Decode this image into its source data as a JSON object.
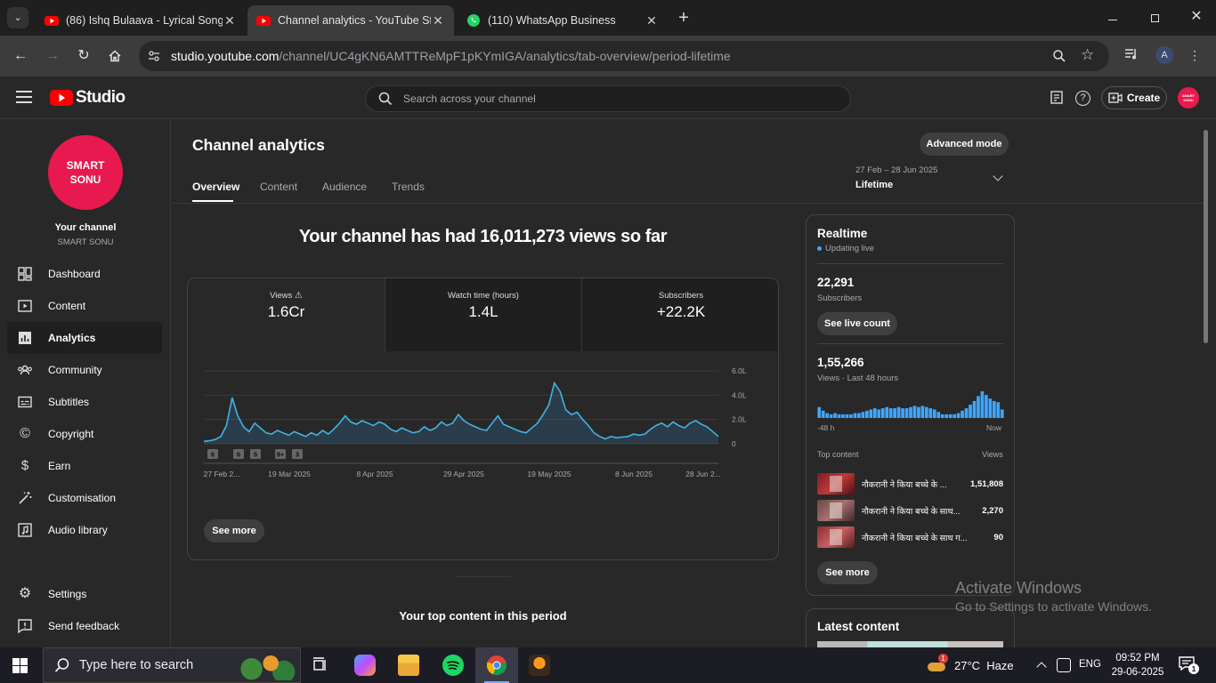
{
  "browser": {
    "tabs": [
      {
        "title": "(86) Ishq Bulaava - Lyrical Song",
        "icon": "youtube-icon"
      },
      {
        "title": "Channel analytics - YouTube Studio",
        "icon": "youtube-icon"
      },
      {
        "title": "(110) WhatsApp Business",
        "icon": "whatsapp-icon"
      }
    ],
    "url_host": "studio.youtube.com",
    "url_path": "/channel/UC4gKN6AMTTReMpF1pKYmIGA/analytics/tab-overview/period-lifetime",
    "profile_initial": "A"
  },
  "header": {
    "logo_text": "Studio",
    "search_placeholder": "Search across your channel",
    "create_label": "Create",
    "avatar_text": "SMART SONU"
  },
  "sidebar": {
    "avatar_text": "SMART SONU",
    "your_channel": "Your channel",
    "channel_name": "SMART SONU",
    "items": [
      {
        "label": "Dashboard",
        "icon": "dashboard-icon"
      },
      {
        "label": "Content",
        "icon": "content-icon"
      },
      {
        "label": "Analytics",
        "icon": "analytics-icon"
      },
      {
        "label": "Community",
        "icon": "community-icon"
      },
      {
        "label": "Subtitles",
        "icon": "subtitles-icon"
      },
      {
        "label": "Copyright",
        "icon": "copyright-icon"
      },
      {
        "label": "Earn",
        "icon": "earn-icon"
      },
      {
        "label": "Customisation",
        "icon": "customisation-icon"
      },
      {
        "label": "Audio library",
        "icon": "audio-library-icon"
      }
    ],
    "settings": "Settings",
    "feedback": "Send feedback"
  },
  "page": {
    "title": "Channel analytics",
    "advanced_mode": "Advanced mode",
    "tabs": [
      "Overview",
      "Content",
      "Audience",
      "Trends"
    ],
    "period_range": "27 Feb – 28 Jun 2025",
    "period_label": "Lifetime",
    "headline": "Your channel has had 16,011,273 views so far",
    "metrics": [
      {
        "label": "Views",
        "value": "1.6Cr"
      },
      {
        "label": "Watch time (hours)",
        "value": "1.4L"
      },
      {
        "label": "Subscribers",
        "value": "+22.2K"
      }
    ],
    "see_more": "See more",
    "top_content_heading": "Your top content in this period"
  },
  "chart_data": {
    "type": "area",
    "x_ticks": [
      "27 Feb 2...",
      "19 Mar 2025",
      "8 Apr 2025",
      "29 Apr 2025",
      "19 May 2025",
      "8 Jun 2025",
      "28 Jun 2..."
    ],
    "y_ticks": [
      "6.0L",
      "4.0L",
      "2.0L",
      "0"
    ],
    "ylim": [
      0,
      600000
    ],
    "values": [
      20000,
      25000,
      35000,
      60000,
      150000,
      380000,
      230000,
      140000,
      100000,
      170000,
      130000,
      90000,
      80000,
      110000,
      90000,
      70000,
      100000,
      80000,
      60000,
      90000,
      70000,
      110000,
      80000,
      120000,
      170000,
      230000,
      180000,
      160000,
      190000,
      170000,
      150000,
      180000,
      160000,
      120000,
      100000,
      130000,
      110000,
      90000,
      100000,
      140000,
      110000,
      130000,
      180000,
      150000,
      170000,
      240000,
      190000,
      160000,
      140000,
      120000,
      110000,
      170000,
      230000,
      160000,
      140000,
      120000,
      100000,
      90000,
      130000,
      170000,
      240000,
      320000,
      500000,
      430000,
      280000,
      240000,
      260000,
      200000,
      150000,
      90000,
      60000,
      40000,
      60000,
      50000,
      55000,
      60000,
      80000,
      70000,
      80000,
      120000,
      150000,
      170000,
      140000,
      180000,
      150000,
      130000,
      170000,
      190000,
      160000,
      140000,
      100000,
      60000
    ],
    "markers": [
      "6",
      "6",
      "5",
      "9+",
      "3"
    ]
  },
  "realtime": {
    "title": "Realtime",
    "live": "Updating live",
    "subscribers": "22,291",
    "subscribers_label": "Subscribers",
    "see_live": "See live count",
    "views": "1,55,266",
    "views_label": "Views · Last 48 hours",
    "bars": [
      9,
      6,
      4,
      3,
      4,
      3,
      3,
      3,
      3,
      4,
      4,
      5,
      6,
      7,
      8,
      7,
      8,
      9,
      8,
      8,
      9,
      8,
      8,
      9,
      10,
      9,
      10,
      9,
      8,
      7,
      5,
      3,
      3,
      3,
      3,
      4,
      6,
      8,
      11,
      14,
      18,
      22,
      19,
      16,
      14,
      13,
      7
    ],
    "axis_left": "-48 h",
    "axis_right": "Now",
    "top_content": "Top content",
    "views_col": "Views",
    "items": [
      {
        "title": "नौकरानी ने किया बच्चे के ...",
        "views": "1,51,808"
      },
      {
        "title": "नौकरानी ने किया बच्चे के साथ...",
        "views": "2,270"
      },
      {
        "title": "नौकरानी ने किया बच्चे के साथ ग...",
        "views": "90"
      }
    ],
    "see_more": "See more"
  },
  "latest": {
    "title": "Latest content"
  },
  "watermark": {
    "line1": "Activate Windows",
    "line2": "Go to Settings to activate Windows."
  },
  "taskbar": {
    "search": "Type here to search",
    "weather": "27°C  Haze",
    "lang": "ENG",
    "time": "09:52 PM",
    "date": "29-06-2025",
    "notif_count": "1",
    "weather_badge": "1"
  }
}
